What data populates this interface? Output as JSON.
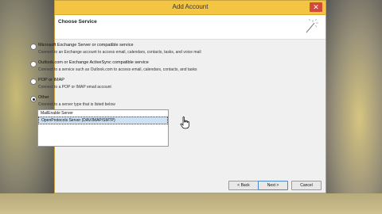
{
  "window": {
    "title": "Add Account",
    "close_glyph": "✕"
  },
  "header": {
    "heading": "Choose Service",
    "icon": "magic-wand-icon"
  },
  "options": [
    {
      "label": "Microsoft Exchange Server or compatible service",
      "description": "Connect to an Exchange account to access email, calendars, contacts, tasks, and voice mail",
      "checked": false
    },
    {
      "label": "Outlook.com or Exchange ActiveSync compatible service",
      "description": "Connect to a service such as Outlook.com to access email, calendars, contacts, and tasks",
      "checked": false
    },
    {
      "label": "POP or IMAP",
      "description": "Connect to a POP or IMAP email account",
      "checked": false
    },
    {
      "label": "Other",
      "description": "Connect to a server type that is listed below",
      "checked": true
    }
  ],
  "server_list": {
    "items": [
      "MailEnable Server",
      "OpenProtocols Server (DAV/IMAP/SMTP)"
    ],
    "selected_index": 1
  },
  "buttons": {
    "back": "< Back",
    "next": "Next >",
    "cancel": "Cancel"
  },
  "colors": {
    "titlebar": "#f4c542",
    "accent_border": "#c8a23a",
    "selection": "#cde0f4"
  }
}
